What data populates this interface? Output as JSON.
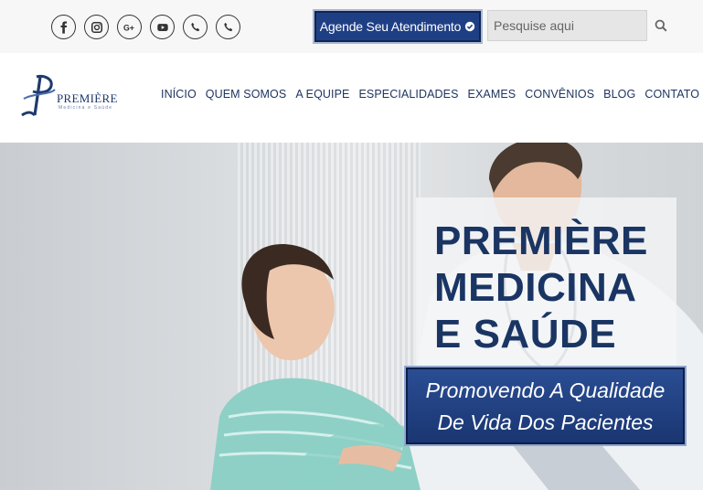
{
  "topbar": {
    "social_icons": [
      "facebook-icon",
      "instagram-icon",
      "google-plus-icon",
      "youtube-icon",
      "phone-icon",
      "phone-icon"
    ],
    "cta_label": "Agende Seu Atendimento",
    "search_placeholder": "Pesquise aqui"
  },
  "brand": {
    "name": "PREMIÈRE",
    "tagline": "Medicina e Saúde"
  },
  "nav": {
    "items": [
      "INÍCIO",
      "QUEM SOMOS",
      "A EQUIPE",
      "ESPECIALIDADES",
      "EXAMES",
      "CONVÊNIOS",
      "BLOG",
      "CONTATO"
    ]
  },
  "hero": {
    "title_lines": [
      "PREMIÈRE",
      "MEDICINA",
      "E SAÚDE"
    ],
    "tagline_lines": [
      "Promovendo A Qualidade",
      "De Vida Dos Pacientes"
    ]
  },
  "colors": {
    "brand_blue": "#1a3563",
    "cta_blue": "#1f3f85"
  }
}
